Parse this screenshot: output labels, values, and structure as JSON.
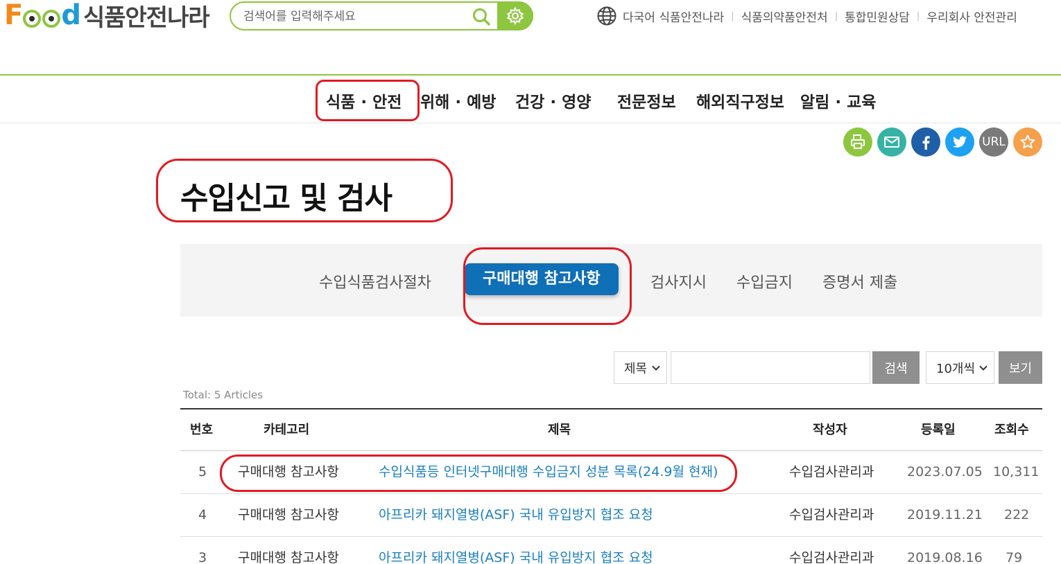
{
  "header": {
    "logo": {
      "food_text": "Food",
      "korean_name": "식품안전나라"
    },
    "search": {
      "placeholder": "검색어를 입력해주세요"
    },
    "util_links": [
      "다국어 식품안전나라",
      "식품의약품안전처",
      "통합민원상담",
      "우리회사 안전관리"
    ]
  },
  "gnb": {
    "items": [
      "식품 · 안전",
      "위해 · 예방",
      "건강 · 영양",
      "전문정보",
      "해외직구정보",
      "알림 · 교육"
    ]
  },
  "share": {
    "url_label": "URL",
    "buttons": [
      {
        "name": "print-icon",
        "color": "#8dc63f"
      },
      {
        "name": "mail-icon",
        "color": "#36b3a6"
      },
      {
        "name": "facebook-icon",
        "color": "#1f5fa8"
      },
      {
        "name": "twitter-icon",
        "color": "#1da1f2"
      },
      {
        "name": "url-icon",
        "color": "#7a7a7a"
      },
      {
        "name": "star-icon",
        "color": "#f5a04a"
      }
    ]
  },
  "page": {
    "title": "수입신고 및 검사"
  },
  "tabs": {
    "items": [
      "수입식품검사절차",
      "구매대행 참고사항",
      "검사지시",
      "수입금지",
      "증명서 제출"
    ],
    "active_index": 1
  },
  "search_bar": {
    "field_select": "제목",
    "keyword": "",
    "search_label": "검색",
    "per_page_select": "10개씩",
    "view_label": "보기"
  },
  "list": {
    "total_text": "Total: 5 Articles",
    "columns": [
      "번호",
      "카테고리",
      "제목",
      "작성자",
      "등록일",
      "조회수"
    ],
    "rows": [
      {
        "no": "5",
        "category": "구매대행 참고사항",
        "title": "수입식품등 인터넷구매대행 수입금지 성분 목록(24.9월 현재)",
        "author": "수입검사관리과",
        "date": "2023.07.05",
        "views": "10,311"
      },
      {
        "no": "4",
        "category": "구매대행 참고사항",
        "title": "아프리카 돼지열병(ASF) 국내 유입방지 협조 요청",
        "author": "수입검사관리과",
        "date": "2019.11.21",
        "views": "222"
      },
      {
        "no": "3",
        "category": "구매대행 참고사항",
        "title": "아프리카 돼지열병(ASF) 국내 유입방지 협조 요청",
        "author": "수입검사관리과",
        "date": "2019.08.16",
        "views": "79"
      }
    ]
  },
  "colors": {
    "brand_green": "#8dc63f",
    "active_tab_blue": "#0f6fb7",
    "link_blue": "#1a7fbf",
    "annotation_red": "#e01a22"
  }
}
